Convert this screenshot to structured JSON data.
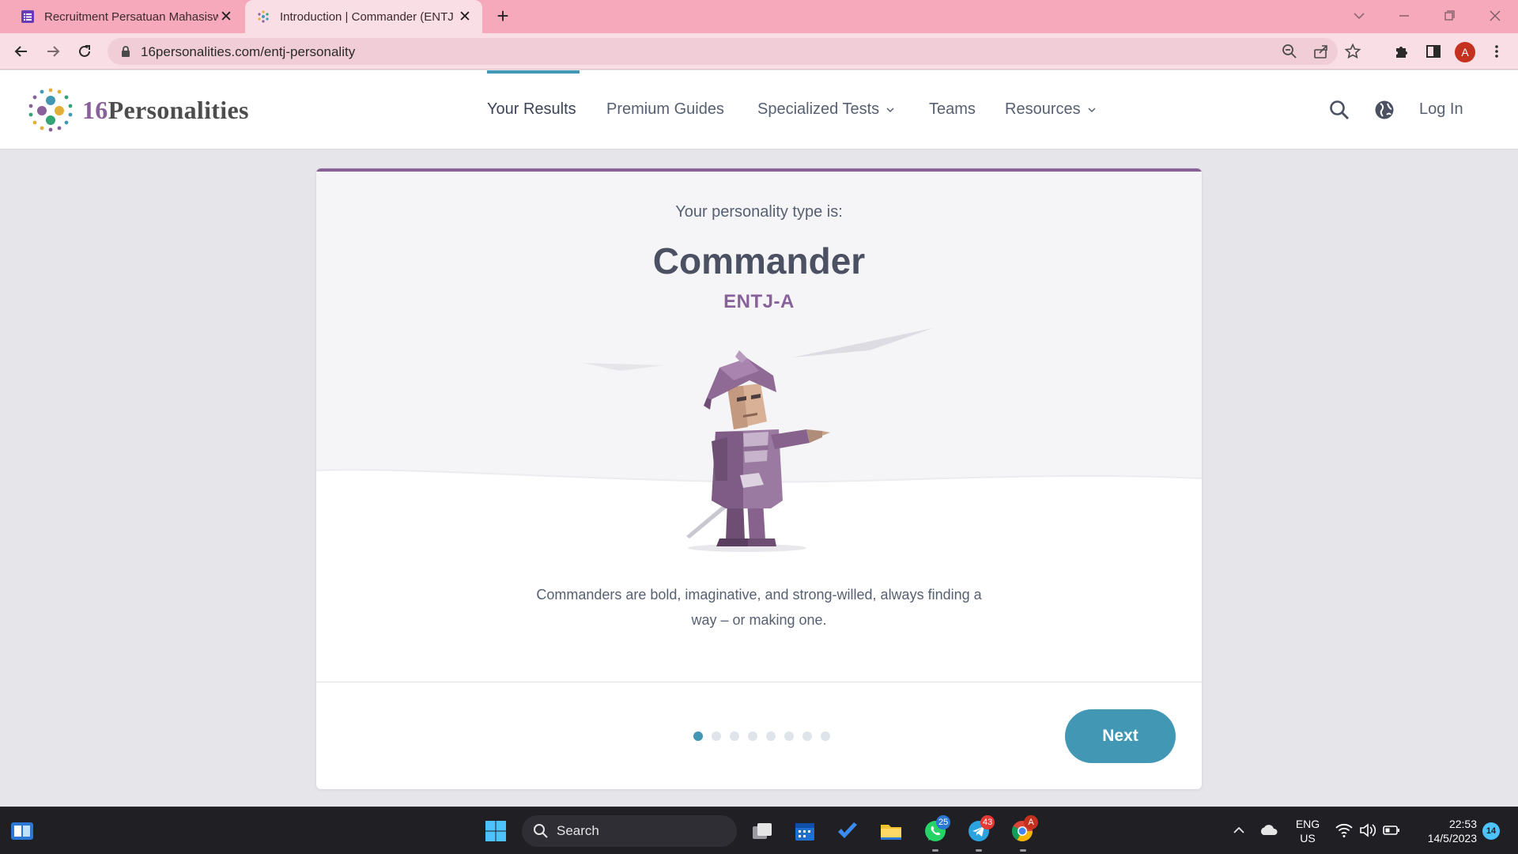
{
  "browser": {
    "tabs": [
      {
        "title": "Recruitment Persatuan Mahasiswa",
        "active": false,
        "close": "✕"
      },
      {
        "title": "Introduction | Commander (ENTJ",
        "active": true,
        "close": "✕"
      }
    ],
    "new_tab": "+",
    "url": "16personalities.com/entj-personality",
    "profile_initial": "A"
  },
  "site": {
    "logo_number": "16",
    "logo_word": "Personalities",
    "nav": [
      {
        "label": "Your Results",
        "active": true,
        "dropdown": false
      },
      {
        "label": "Premium Guides",
        "active": false,
        "dropdown": false
      },
      {
        "label": "Specialized Tests",
        "active": false,
        "dropdown": true
      },
      {
        "label": "Teams",
        "active": false,
        "dropdown": false
      },
      {
        "label": "Resources",
        "active": false,
        "dropdown": true
      }
    ],
    "login_label": "Log In"
  },
  "result": {
    "intro": "Your personality type is:",
    "type_name": "Commander",
    "type_code": "ENTJ-A",
    "description": "Commanders are bold, imaginative, and strong-willed, always finding a way – or making one.",
    "pagination_total": 8,
    "pagination_current": 1,
    "next_label": "Next"
  },
  "taskbar": {
    "search_label": "Search",
    "whatsapp_badge": "25",
    "telegram_badge": "43",
    "chrome_badge": "A",
    "language": "ENG",
    "region": "US",
    "time": "22:53",
    "date": "14/5/2023",
    "notifications": "14"
  },
  "colors": {
    "tab_bar": "#f6a9bb",
    "toolbar": "#f9dee6",
    "accent_purple": "#88619a",
    "accent_blue": "#4298b4",
    "text_dark": "#4b5162"
  }
}
